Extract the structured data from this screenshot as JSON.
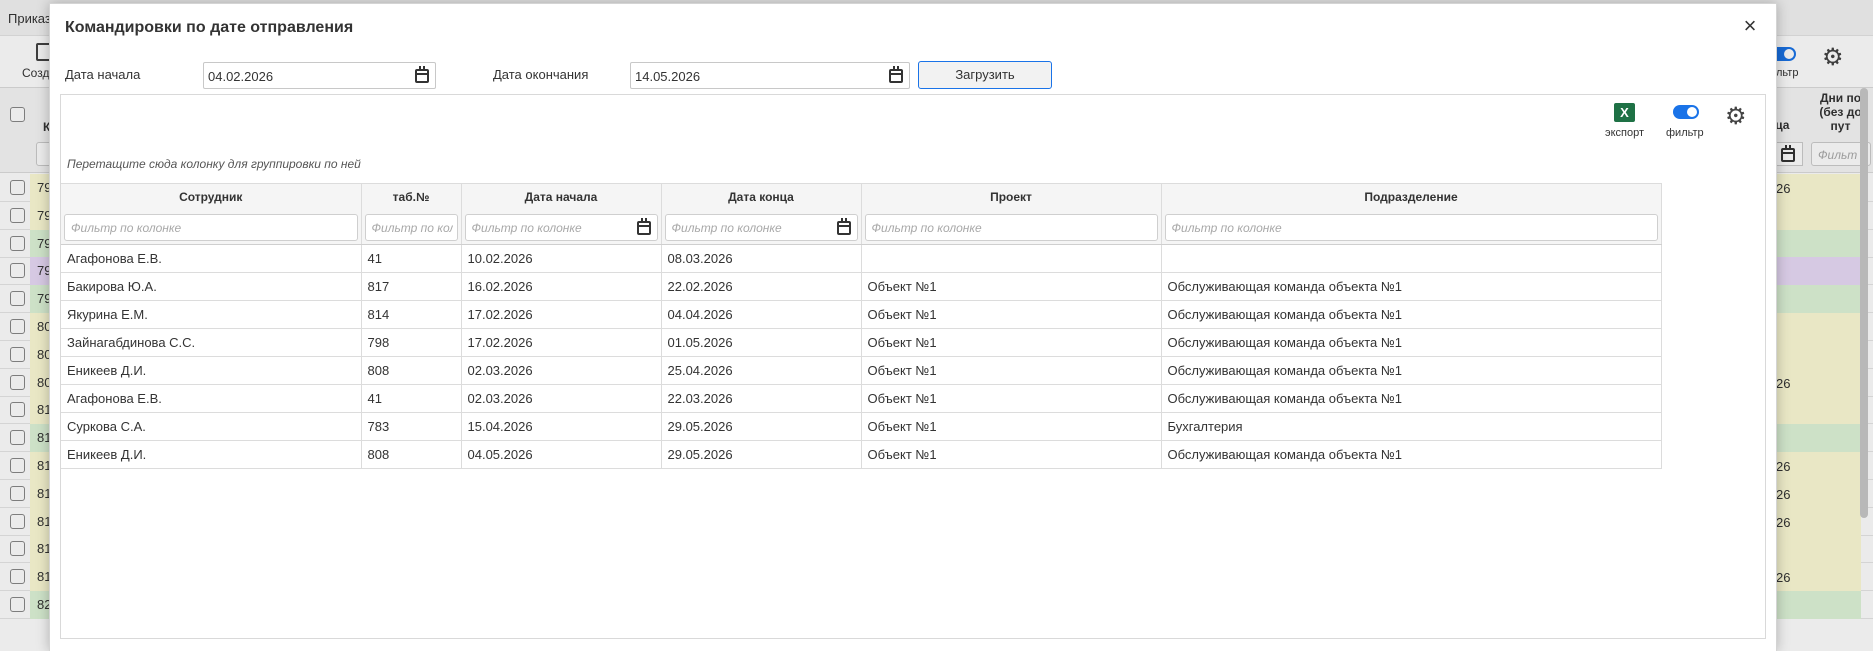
{
  "background": {
    "title": "Приказ",
    "create_label": "Созд",
    "filter_label": "льтр",
    "header_col_k": "К",
    "header_col_end": "нца",
    "header_col_days": "Дни по (без до пут",
    "days_filter_placeholder": "Фильт",
    "rows": [
      {
        "lead": "79",
        "value": "26",
        "lead_color": "#fdfbd6",
        "right_color": "#fdfbd6"
      },
      {
        "lead": "79",
        "value": "",
        "lead_color": "#fdfbd6",
        "right_color": "#fdfbd6"
      },
      {
        "lead": "79",
        "value": "",
        "lead_color": "#dff5d8",
        "right_color": "#dff5d8"
      },
      {
        "lead": "79",
        "value": "",
        "lead_color": "#e9dbf7",
        "right_color": "#e9dbf7"
      },
      {
        "lead": "79",
        "value": "",
        "lead_color": "#dff5d8",
        "right_color": "#dff5d8"
      },
      {
        "lead": "80",
        "value": "",
        "lead_color": "#fdfbd6",
        "right_color": "#fdfbd6"
      },
      {
        "lead": "80",
        "value": "",
        "lead_color": "#fdfbd6",
        "right_color": "#fdfbd6"
      },
      {
        "lead": "80",
        "value": "26",
        "lead_color": "#fdfbd6",
        "right_color": "#fdfbd6"
      },
      {
        "lead": "81",
        "value": "",
        "lead_color": "#fdfbd6",
        "right_color": "#fdfbd6"
      },
      {
        "lead": "81",
        "value": "",
        "lead_color": "#dff5d8",
        "right_color": "#dff5d8"
      },
      {
        "lead": "81",
        "value": "26",
        "lead_color": "#fdfbd6",
        "right_color": "#fdfbd6"
      },
      {
        "lead": "81",
        "value": "26",
        "lead_color": "#fdfbd6",
        "right_color": "#fdfbd6"
      },
      {
        "lead": "81",
        "value": "26",
        "lead_color": "#fdfbd6",
        "right_color": "#fdfbd6"
      },
      {
        "lead": "81",
        "value": "",
        "lead_color": "#fdfbd6",
        "right_color": "#fdfbd6"
      },
      {
        "lead": "81",
        "value": "26",
        "lead_color": "#fdfbd6",
        "right_color": "#fdfbd6"
      },
      {
        "lead": "82",
        "value": "",
        "lead_color": "#dff5d8",
        "right_color": "#dff5d8"
      }
    ]
  },
  "modal": {
    "title": "Командировки по дате отправления",
    "close_symbol": "×",
    "start_label": "Дата начала",
    "start_value": "04.02.2026",
    "end_label": "Дата окончания",
    "end_value": "14.05.2026",
    "load_button": "Загрузить",
    "export_label": "экспорт",
    "excel_icon_letter": "X",
    "filter_label": "фильтр",
    "gear_symbol": "⚙",
    "group_hint": "Перетащите сюда колонку для группировки по ней",
    "filter_placeholder": "Фильтр по колонке",
    "columns": [
      "Сотрудник",
      "таб.№",
      "Дата начала",
      "Дата конца",
      "Проект",
      "Подразделение"
    ],
    "rows": [
      [
        "Агафонова Е.В.",
        "41",
        "10.02.2026",
        "08.03.2026",
        "",
        ""
      ],
      [
        "Бакирова Ю.А.",
        "817",
        "16.02.2026",
        "22.02.2026",
        "Объект №1",
        "Обслуживающая команда объекта №1"
      ],
      [
        "Якурина Е.М.",
        "814",
        "17.02.2026",
        "04.04.2026",
        "Объект №1",
        "Обслуживающая команда объекта №1"
      ],
      [
        "Зайнагабдинова С.С.",
        "798",
        "17.02.2026",
        "01.05.2026",
        "Объект №1",
        "Обслуживающая команда объекта №1"
      ],
      [
        "Еникеев Д.И.",
        "808",
        "02.03.2026",
        "25.04.2026",
        "Объект №1",
        "Обслуживающая команда объекта №1"
      ],
      [
        "Агафонова Е.В.",
        "41",
        "02.03.2026",
        "22.03.2026",
        "Объект №1",
        "Обслуживающая команда объекта №1"
      ],
      [
        "Суркова С.А.",
        "783",
        "15.04.2026",
        "29.05.2026",
        "Объект №1",
        "Бухгалтерия"
      ],
      [
        "Еникеев Д.И.",
        "808",
        "04.05.2026",
        "29.05.2026",
        "Объект №1",
        "Обслуживающая команда объекта №1"
      ]
    ]
  }
}
